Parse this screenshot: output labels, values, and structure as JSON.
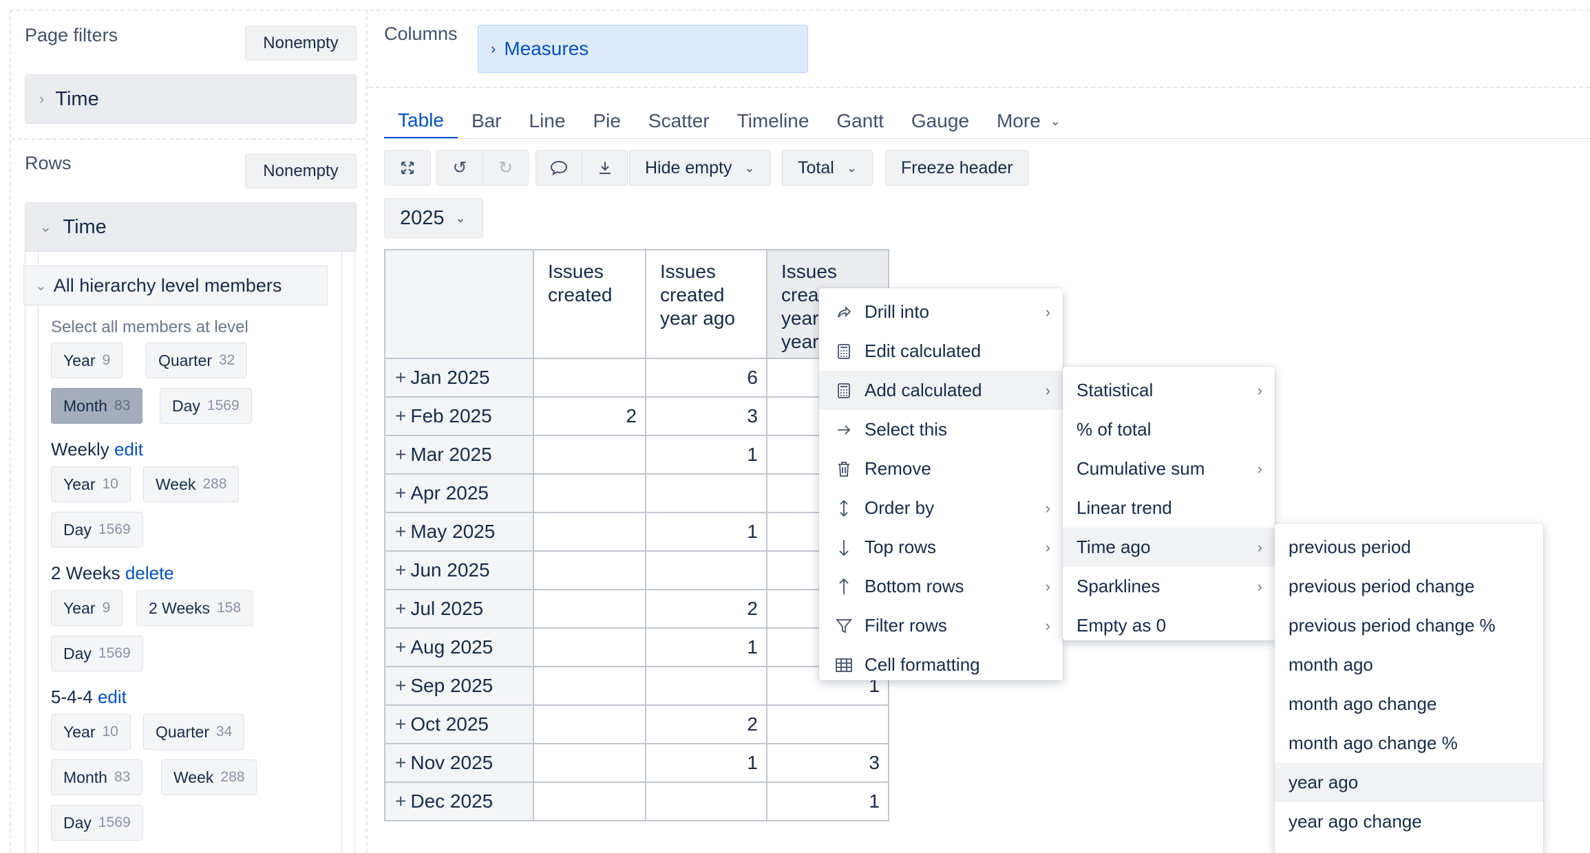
{
  "left": {
    "page_filters": {
      "title": "Page filters",
      "nonempty_label": "Nonempty",
      "dimension": "Time"
    },
    "rows": {
      "title": "Rows",
      "nonempty_label": "Nonempty",
      "dimension": "Time"
    },
    "hierarchy_header": "All hierarchy level members",
    "select_all_label": "Select all members at level",
    "default_levels": [
      {
        "name": "Year",
        "count": "9"
      },
      {
        "name": "Quarter",
        "count": "32"
      },
      {
        "name": "Month",
        "count": "83",
        "selected": true
      },
      {
        "name": "Day",
        "count": "1569"
      }
    ],
    "weekly": {
      "title": "Weekly",
      "action": "edit",
      "levels": [
        {
          "name": "Year",
          "count": "10"
        },
        {
          "name": "Week",
          "count": "288"
        },
        {
          "name": "Day",
          "count": "1569"
        }
      ]
    },
    "two_weeks": {
      "title": "2 Weeks",
      "action": "delete",
      "levels": [
        {
          "name": "Year",
          "count": "9"
        },
        {
          "name": "2 Weeks",
          "count": "158"
        },
        {
          "name": "Day",
          "count": "1569"
        }
      ]
    },
    "five_four_four": {
      "title": "5-4-4",
      "action": "edit",
      "levels": [
        {
          "name": "Year",
          "count": "10"
        },
        {
          "name": "Quarter",
          "count": "34"
        },
        {
          "name": "Month",
          "count": "83"
        },
        {
          "name": "Week",
          "count": "288"
        },
        {
          "name": "Day",
          "count": "1569"
        }
      ]
    }
  },
  "columns": {
    "title": "Columns",
    "measures_label": "Measures"
  },
  "tabs": [
    "Table",
    "Bar",
    "Line",
    "Pie",
    "Scatter",
    "Timeline",
    "Gantt",
    "Gauge",
    "More"
  ],
  "active_tab": "Table",
  "toolbar": {
    "hide_empty": "Hide empty",
    "total": "Total",
    "freeze_header": "Freeze header"
  },
  "year_selector": "2025",
  "table": {
    "headers": [
      "Issues created",
      "Issues created year ago",
      "Issues created year ago year"
    ],
    "header3_visible": [
      "Issues",
      "crea",
      "year",
      "year"
    ],
    "rows": [
      {
        "label": "Jan 2025",
        "c1": "",
        "c2": "6",
        "c3": ""
      },
      {
        "label": "Feb 2025",
        "c1": "2",
        "c2": "3",
        "c3": ""
      },
      {
        "label": "Mar 2025",
        "c1": "",
        "c2": "1",
        "c3": ""
      },
      {
        "label": "Apr 2025",
        "c1": "",
        "c2": "",
        "c3": ""
      },
      {
        "label": "May 2025",
        "c1": "",
        "c2": "1",
        "c3": ""
      },
      {
        "label": "Jun 2025",
        "c1": "",
        "c2": "",
        "c3": ""
      },
      {
        "label": "Jul 2025",
        "c1": "",
        "c2": "2",
        "c3": ""
      },
      {
        "label": "Aug 2025",
        "c1": "",
        "c2": "1",
        "c3": ""
      },
      {
        "label": "Sep 2025",
        "c1": "",
        "c2": "",
        "c3": "1"
      },
      {
        "label": "Oct 2025",
        "c1": "",
        "c2": "2",
        "c3": ""
      },
      {
        "label": "Nov 2025",
        "c1": "",
        "c2": "1",
        "c3": "3"
      },
      {
        "label": "Dec 2025",
        "c1": "",
        "c2": "",
        "c3": "1"
      }
    ]
  },
  "context_menu": {
    "items": [
      {
        "label": "Drill into",
        "icon": "share-arrow-icon",
        "submenu": true
      },
      {
        "label": "Edit calculated",
        "icon": "calculator-icon",
        "submenu": false
      },
      {
        "label": "Add calculated",
        "icon": "calculator-icon",
        "submenu": true,
        "highlighted": true
      },
      {
        "label": "Select this",
        "icon": "arrow-right-icon",
        "submenu": false
      },
      {
        "label": "Remove",
        "icon": "trash-icon",
        "submenu": false
      },
      {
        "label": "Order by",
        "icon": "sort-vertical-icon",
        "submenu": true
      },
      {
        "label": "Top rows",
        "icon": "arrow-down-icon",
        "submenu": true
      },
      {
        "label": "Bottom rows",
        "icon": "arrow-up-icon",
        "submenu": true
      },
      {
        "label": "Filter rows",
        "icon": "filter-icon",
        "submenu": true
      },
      {
        "label": "Cell formatting",
        "icon": "table-grid-icon",
        "submenu": false
      }
    ]
  },
  "add_calculated_menu": {
    "items": [
      {
        "label": "Statistical",
        "submenu": true
      },
      {
        "label": "% of total",
        "submenu": false
      },
      {
        "label": "Cumulative sum",
        "submenu": true
      },
      {
        "label": "Linear trend",
        "submenu": false
      },
      {
        "label": "Time ago",
        "submenu": true,
        "highlighted": true
      },
      {
        "label": "Sparklines",
        "submenu": true
      },
      {
        "label": "Empty as 0",
        "submenu": false
      }
    ]
  },
  "time_ago_menu": {
    "items": [
      {
        "label": "previous period"
      },
      {
        "label": "previous period change"
      },
      {
        "label": "previous period change %"
      },
      {
        "label": "month ago"
      },
      {
        "label": "month ago change"
      },
      {
        "label": "month ago change %"
      },
      {
        "label": "year ago",
        "highlighted": true
      },
      {
        "label": "year ago change"
      }
    ]
  }
}
